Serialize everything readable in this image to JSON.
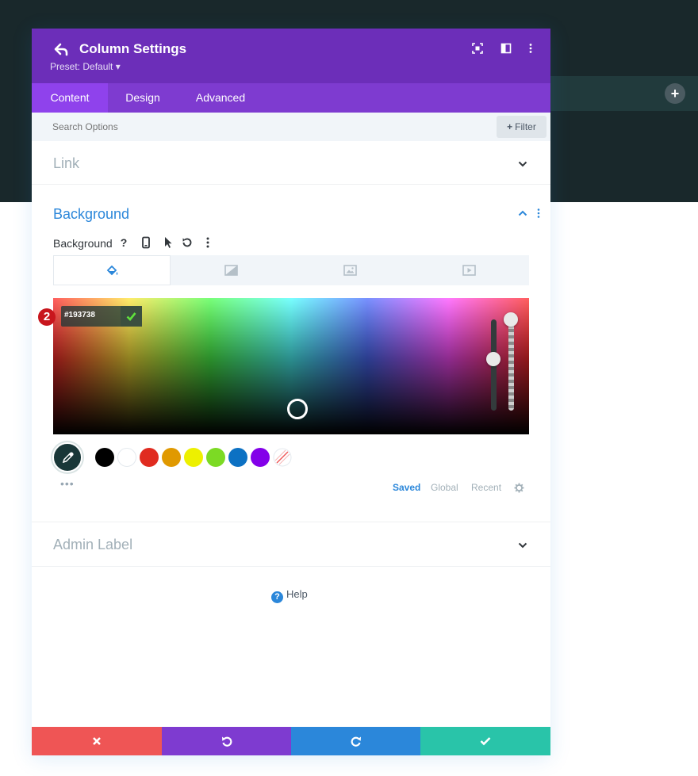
{
  "header": {
    "title": "Column Settings",
    "preset": "Preset: Default ▾"
  },
  "tabs": [
    {
      "label": "Content"
    },
    {
      "label": "Design"
    },
    {
      "label": "Advanced"
    }
  ],
  "search": {
    "placeholder": "Search Options",
    "filter_label": "Filter"
  },
  "sections": {
    "link": "Link",
    "background": "Background",
    "admin_label": "Admin Label"
  },
  "background_option": {
    "label": "Background"
  },
  "color_picker": {
    "hex_value": "#193738",
    "step_badge": "2",
    "swatches": [
      "#000000",
      "#ffffff",
      "#e02b20",
      "#e09900",
      "#edf000",
      "#7cda24",
      "#0c71c3",
      "#8300e9"
    ]
  },
  "palette_tabs": [
    {
      "label": "Saved"
    },
    {
      "label": "Global"
    },
    {
      "label": "Recent"
    }
  ],
  "help": "Help",
  "colors": {
    "header": "#6c2eb9",
    "accent": "#2b87da",
    "cancel": "#ef5555",
    "undo": "#7e3bd0",
    "redo": "#2b87da",
    "save": "#29c4a9"
  }
}
